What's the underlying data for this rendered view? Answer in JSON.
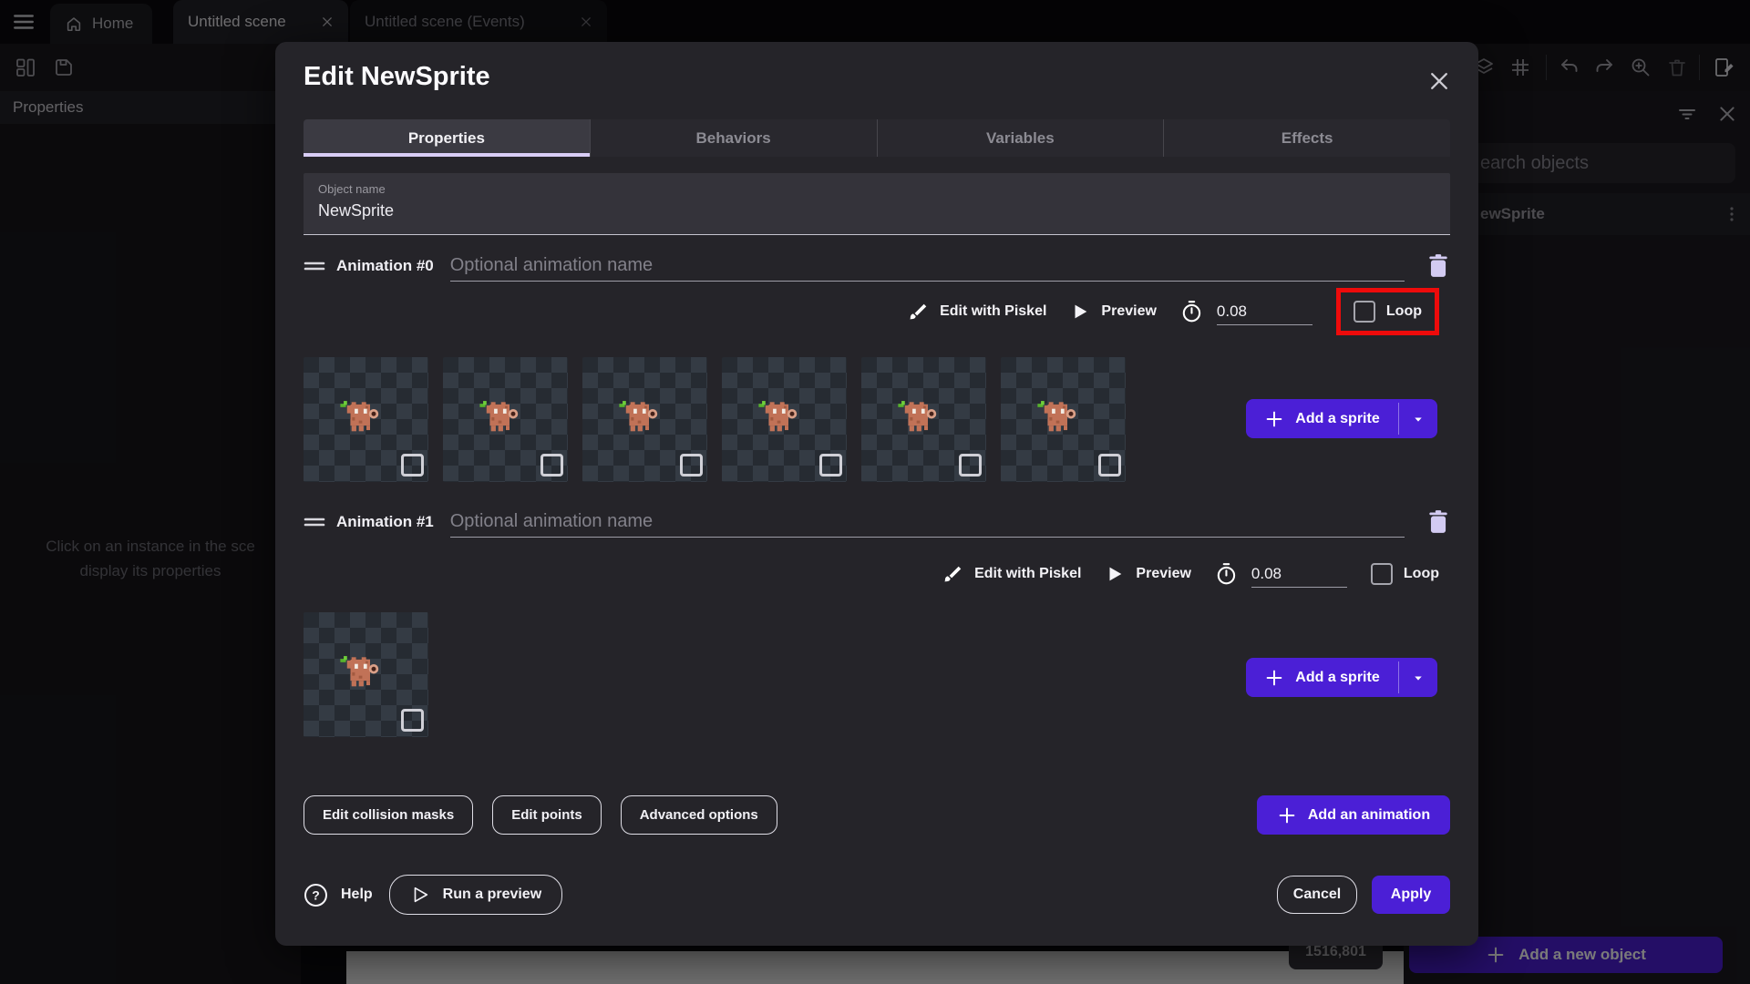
{
  "colors": {
    "accent": "#4b1fd6",
    "loop_highlight": "#ee0b0b"
  },
  "app": {
    "tabs": [
      {
        "label": "Home"
      },
      {
        "label": "Untitled scene"
      },
      {
        "label": "Untitled scene (Events)"
      }
    ],
    "left_panel": {
      "header": "Properties",
      "empty_state_line1": "Click on an instance in the sce",
      "empty_state_line2": "display its properties"
    },
    "right_panel": {
      "search_placeholder": "earch objects",
      "object_row_label": "ewSprite",
      "add_new_object_label": "Add a new object"
    },
    "canvas": {
      "coordinate_badge": "1516,801"
    }
  },
  "dialog": {
    "title": "Edit NewSprite",
    "tabs": [
      {
        "label": "Properties",
        "active": true
      },
      {
        "label": "Behaviors",
        "active": false
      },
      {
        "label": "Variables",
        "active": false
      },
      {
        "label": "Effects",
        "active": false
      }
    ],
    "object_name": {
      "label": "Object name",
      "value": "NewSprite"
    },
    "animations": [
      {
        "title": "Animation #0",
        "name_placeholder": "Optional animation name",
        "edit_with_piskel": "Edit with Piskel",
        "preview": "Preview",
        "time_between_frames": "0.08",
        "loop": "Loop",
        "frames": 6,
        "loop_highlighted": true
      },
      {
        "title": "Animation #1",
        "name_placeholder": "Optional animation name",
        "edit_with_piskel": "Edit with Piskel",
        "preview": "Preview",
        "time_between_frames": "0.08",
        "loop": "Loop",
        "frames": 1,
        "loop_highlighted": false
      }
    ],
    "add_sprite_label": "Add a sprite",
    "actions": {
      "edit_collision_masks": "Edit collision masks",
      "edit_points": "Edit points",
      "advanced_options": "Advanced options",
      "add_animation": "Add an animation",
      "help": "Help",
      "run_preview": "Run a preview",
      "cancel": "Cancel",
      "apply": "Apply"
    }
  }
}
